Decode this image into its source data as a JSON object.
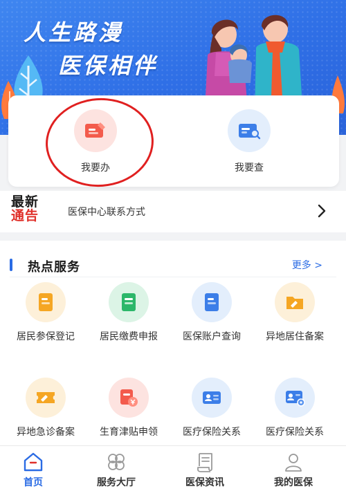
{
  "banner": {
    "title": "人生路漫",
    "subtitle": "医保相伴"
  },
  "quick_actions": [
    {
      "label": "我要办",
      "icon": "card-pen-icon",
      "color": "#f35b4c",
      "bg": "#fde3e0"
    },
    {
      "label": "我要查",
      "icon": "card-search-icon",
      "color": "#3c7ee8",
      "bg": "#e3eefc"
    }
  ],
  "notice": {
    "tag_line1": "最新",
    "tag_line2": "通告",
    "text": "医保中心联系方式"
  },
  "hot_services": {
    "title": "热点服务",
    "more": "更多 >",
    "items": [
      {
        "label": "居民参保登记",
        "icon": "document-icon",
        "color": "#f5a623",
        "bg": "#fdf0d9"
      },
      {
        "label": "居民缴费申报",
        "icon": "document-icon",
        "color": "#2cb76a",
        "bg": "#dcf4e6"
      },
      {
        "label": "医保账户查询",
        "icon": "document-icon",
        "color": "#3c7ee8",
        "bg": "#e3eefc"
      },
      {
        "label": "异地居住备案",
        "icon": "folder-icon",
        "color": "#f5a623",
        "bg": "#fdf0d9"
      },
      {
        "label": "异地急诊备案",
        "icon": "ticket-icon",
        "color": "#f5a623",
        "bg": "#fdf0d9"
      },
      {
        "label": "生育津贴申领",
        "icon": "money-card-icon",
        "color": "#f35b4c",
        "bg": "#fde3e0"
      },
      {
        "label": "医疗保险关系",
        "icon": "id-card-icon",
        "color": "#3c7ee8",
        "bg": "#e3eefc"
      },
      {
        "label": "医疗保险关系",
        "icon": "id-card-add-icon",
        "color": "#3c7ee8",
        "bg": "#e3eefc"
      }
    ]
  },
  "nav": {
    "active": "home",
    "items": [
      {
        "label": "首页",
        "icon": "home-icon"
      },
      {
        "label": "服务大厅",
        "icon": "service-hall-icon"
      },
      {
        "label": "医保资讯",
        "icon": "news-scroll-icon"
      },
      {
        "label": "我的医保",
        "icon": "user-icon"
      }
    ]
  },
  "colors": {
    "accent": "#2a6be4",
    "banner": "#3f86f0",
    "highlight_ring": "#e02020"
  }
}
